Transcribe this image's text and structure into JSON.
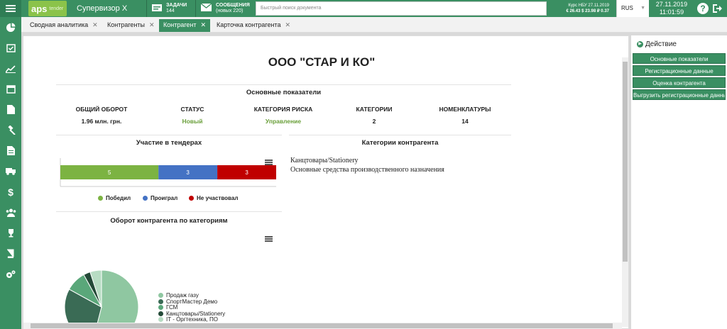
{
  "header": {
    "logo_main": "aps",
    "logo_sub": "tender",
    "user": "Супервизор Х",
    "tasks_label": "ЗАДАЧИ",
    "tasks_count": "144",
    "messages_label": "СООБЩЕНИЯ",
    "messages_count": "(новых 220)",
    "search_placeholder": "Быстрый поиск документа",
    "rate_title": "Курс НБУ 27.11.2019",
    "rate_values": "€ 26.43  $ 23.98  ₽ 0.37",
    "language": "RUS",
    "date": "27.11.2019",
    "time": "11:01:59"
  },
  "tabs": [
    {
      "label": "Сводная аналитика"
    },
    {
      "label": "Контрагенты"
    },
    {
      "label": "Контрагент"
    },
    {
      "label": "Карточка контрагента"
    }
  ],
  "page": {
    "title": "ООО \"СТАР И КО\"",
    "main_section": "Основные показатели",
    "metrics": [
      {
        "label": "ОБЩИЙ ОБОРОТ",
        "value": "1.96 млн. грн."
      },
      {
        "label": "СТАТУС",
        "value": "Новый"
      },
      {
        "label": "КАТЕГОРИЯ РИСКА",
        "value": "Управление"
      },
      {
        "label": "КАТЕГОРИИ",
        "value": "2"
      },
      {
        "label": "НОМЕНКЛАТУРЫ",
        "value": "14"
      }
    ],
    "tenders_title": "Участие в тендерах",
    "categories_title": "Категории контрагента",
    "categories": [
      "Канцтовары/Stationery",
      "Основные средства производственного назначения"
    ],
    "turnover_title": "Оборот контрагента по категориям"
  },
  "colors": {
    "accent": "#3a8f62",
    "won": "#7cb342",
    "lost": "#4472c4",
    "not": "#c00000"
  },
  "chart_data": [
    {
      "type": "bar",
      "title": "Участие в тендерах",
      "orientation": "horizontal-stacked",
      "series": [
        {
          "name": "Победил",
          "values": [
            5
          ],
          "color": "#7cb342"
        },
        {
          "name": "Проиграл",
          "values": [
            3
          ],
          "color": "#4472c4"
        },
        {
          "name": "Не участвовал",
          "values": [
            3
          ],
          "color": "#c00000"
        }
      ],
      "legend": "bottom"
    },
    {
      "type": "pie",
      "title": "Оборот контрагента по категориям",
      "labels": [
        "Продаж газу",
        "СпортМастер Демо",
        "ГСМ",
        "Канцтовары/Stationery",
        "IT - Оргтехника, ПО"
      ],
      "values": [
        54,
        29,
        9,
        3,
        5
      ],
      "colors": [
        "#8fc7a1",
        "#3a6b55",
        "#5aa77a",
        "#244a38",
        "#b7dcc3"
      ],
      "legend": "right"
    }
  ],
  "actions": {
    "title": "Действие",
    "buttons": [
      "Основные показатели",
      "Регистрационные данные",
      "Оценка контрагента",
      "Выгрузить регистрационные данные"
    ]
  }
}
